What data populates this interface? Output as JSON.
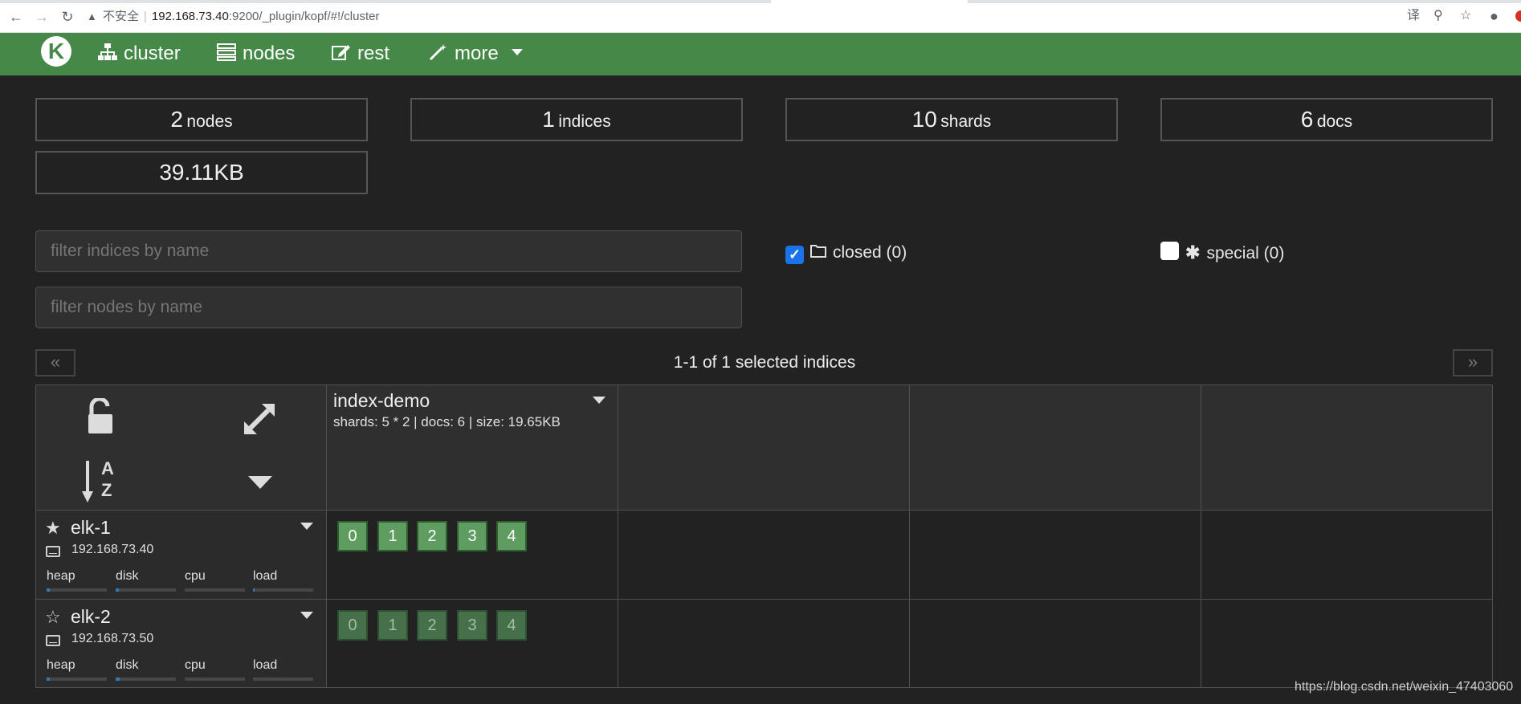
{
  "browser": {
    "insecure_label": "不安全",
    "url_host": "192.168.73.40",
    "url_rest": ":9200/_plugin/kopf/#!/cluster"
  },
  "navbar": {
    "logo_letter": "K",
    "items": [
      {
        "label": "cluster",
        "icon": "sitemap-icon"
      },
      {
        "label": "nodes",
        "icon": "server-icon"
      },
      {
        "label": "rest",
        "icon": "edit-icon"
      },
      {
        "label": "more",
        "icon": "magic-wand-icon"
      }
    ]
  },
  "stats": {
    "nodes": {
      "num": "2",
      "unit": "nodes"
    },
    "indices": {
      "num": "1",
      "unit": "indices"
    },
    "shards": {
      "num": "10",
      "unit": "shards"
    },
    "docs": {
      "num": "6",
      "unit": "docs"
    },
    "size": "39.11KB"
  },
  "filters": {
    "indices_placeholder": "filter indices by name",
    "nodes_placeholder": "filter nodes by name"
  },
  "checkboxes": {
    "closed": {
      "label": "closed (0)",
      "checked": true
    },
    "special": {
      "label": "special (0)",
      "checked": false
    }
  },
  "pager": {
    "prev": "«",
    "next": "»",
    "label": "1-1 of 1 selected indices"
  },
  "index": {
    "name": "index-demo",
    "meta": "shards: 5 * 2 | docs: 6 | size: 19.65KB"
  },
  "sort_icon": {
    "a": "A",
    "z": "Z"
  },
  "nodes": [
    {
      "name": "elk-1",
      "ip": "192.168.73.40",
      "master": true,
      "metrics": [
        {
          "label": "heap",
          "level": 0.05
        },
        {
          "label": "disk",
          "level": 0.05
        },
        {
          "label": "cpu",
          "level": 0.0
        },
        {
          "label": "load",
          "level": 0.02
        }
      ],
      "shards": [
        "0",
        "1",
        "2",
        "3",
        "4"
      ],
      "shard_type": "primary"
    },
    {
      "name": "elk-2",
      "ip": "192.168.73.50",
      "master": false,
      "metrics": [
        {
          "label": "heap",
          "level": 0.05
        },
        {
          "label": "disk",
          "level": 0.07
        },
        {
          "label": "cpu",
          "level": 0.0
        },
        {
          "label": "load",
          "level": 0.0
        }
      ],
      "shards": [
        "0",
        "1",
        "2",
        "3",
        "4"
      ],
      "shard_type": "replica"
    }
  ],
  "watermark": "https://blog.csdn.net/weixin_47403060",
  "colors": {
    "navbar": "#458847",
    "background": "#222222",
    "shard_primary": "#5e9c5f",
    "shard_replica": "#45704a",
    "checkbox": "#1a73e8"
  }
}
